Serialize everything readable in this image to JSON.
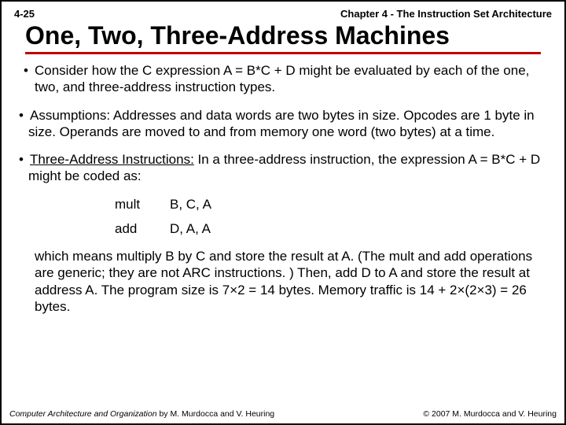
{
  "header": {
    "page_label": "4-25",
    "chapter": "Chapter 4 - The Instruction Set Architecture"
  },
  "title": "One, Two, Three-Address Machines",
  "bullets": {
    "b1": "Consider how the C expression A = B*C + D might be evaluated by each of the one, two, and three-address  instruction types.",
    "b2": "Assumptions: Addresses and data words are two bytes in size. Opcodes are 1 byte in size. Operands are moved to and from memory one word (two bytes) at a time.",
    "b3_prefix": "Three-Address Instructions:",
    "b3_rest": " In a three-address instruction, the expression A = B*C + D might be coded as:"
  },
  "code": {
    "r1_mn": "mult",
    "r1_ops": "B, C, A",
    "r2_mn": "add",
    "r2_ops": "D, A, A"
  },
  "closer": "which means multiply B by C and store the result at A. (The mult and add operations are generic; they are not ARC instructions. ) Then, add D to A and store the result at address A. The program size is 7×2 = 14 bytes. Memory traffic is 14 + 2×(2×3) = 26 bytes.",
  "footer": {
    "book_title": "Computer Architecture and Organization",
    "authors": " by M. Murdocca and V. Heuring",
    "copyright": "© 2007 M. Murdocca and V. Heuring"
  }
}
